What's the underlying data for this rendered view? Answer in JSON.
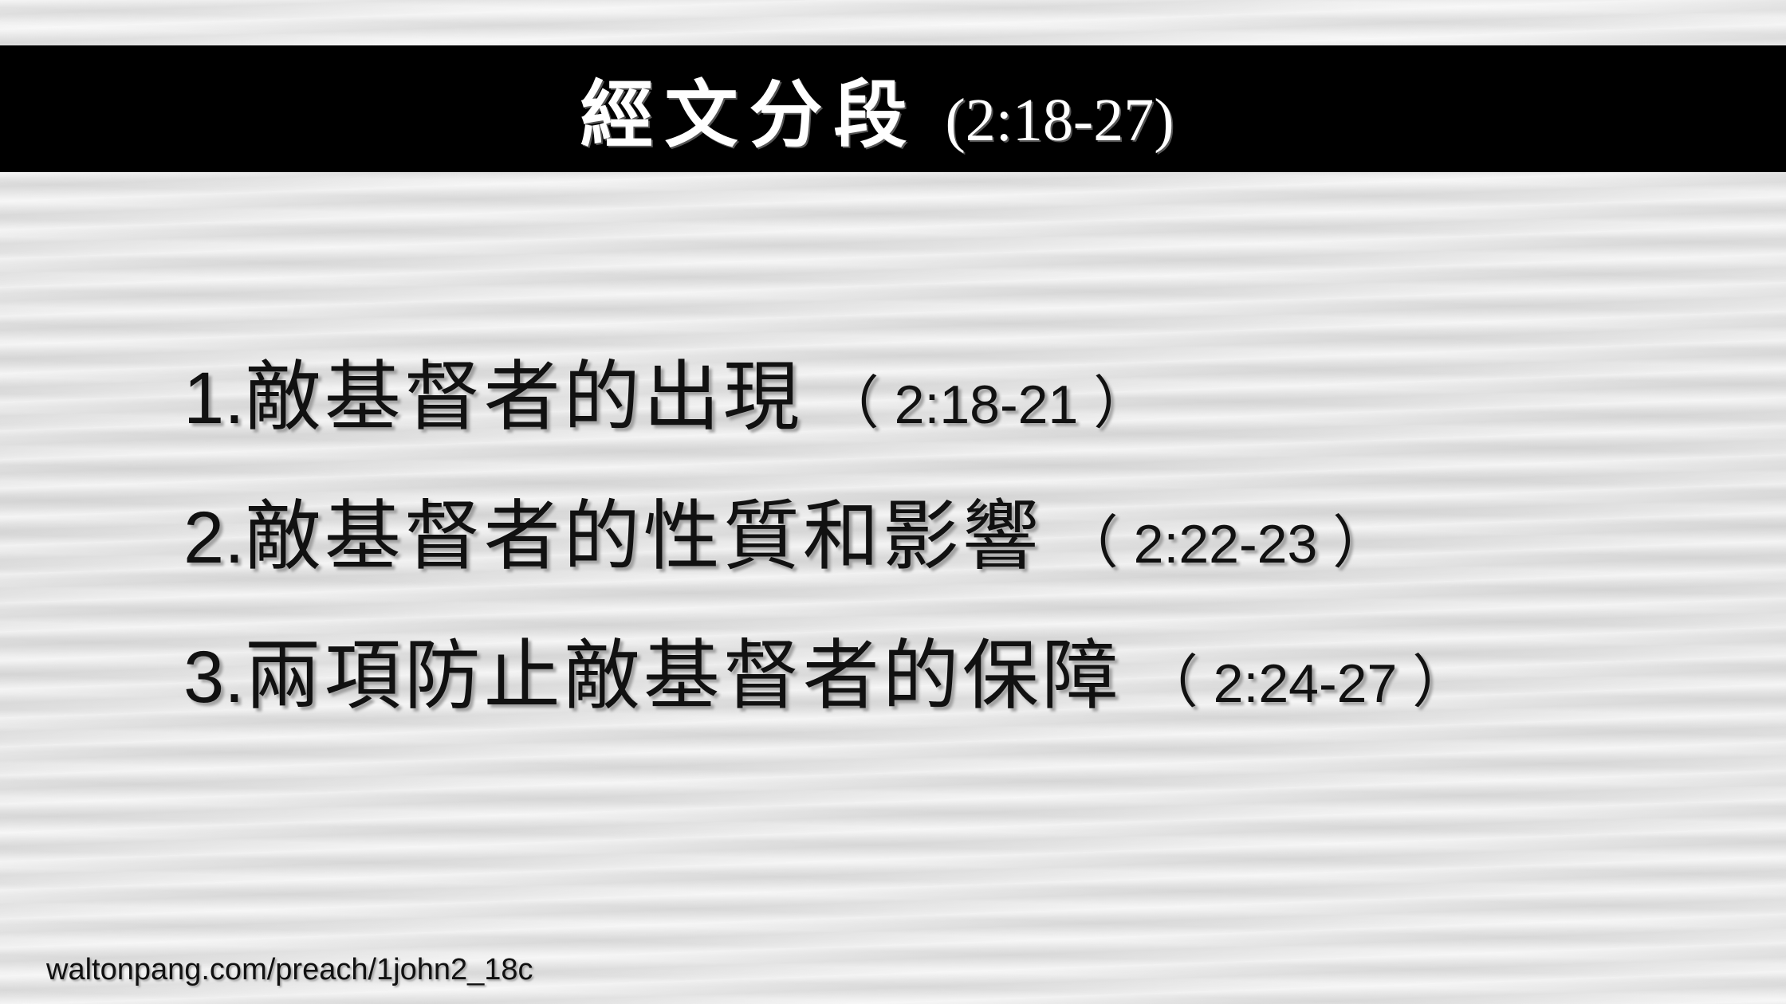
{
  "title": {
    "main": "經文分段",
    "reference": "(2:18-27)"
  },
  "sections": [
    {
      "number": "1.",
      "text": "敵基督者的出現",
      "ref_open": "（",
      "ref": " 2:18-21 ",
      "ref_close": "）"
    },
    {
      "number": "2.",
      "text": "敵基督者的性質和影響",
      "ref_open": "（",
      "ref": " 2:22-23 ",
      "ref_close": "）"
    },
    {
      "number": "3.",
      "text": "兩項防止敵基督者的保障",
      "ref_open": "（",
      "ref": " 2:24-27 ",
      "ref_close": "）"
    }
  ],
  "footer": {
    "url": "waltonpang.com/preach/1john2_18c"
  },
  "colors": {
    "title_bar": "#000000",
    "title_text": "#ffffff",
    "body_text": "#111111",
    "background": "#e6e6e6"
  }
}
